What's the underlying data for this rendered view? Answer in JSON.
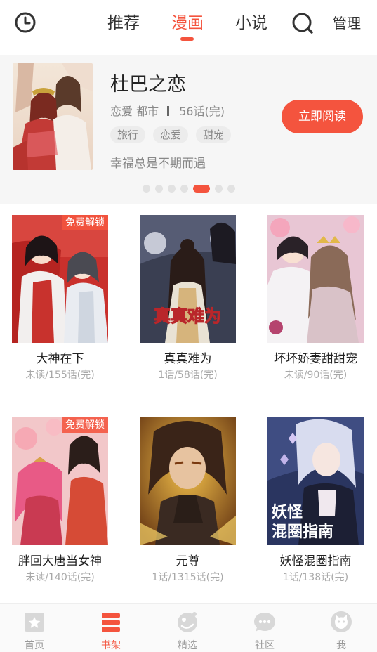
{
  "header": {
    "tabs": [
      {
        "label": "推荐",
        "active": false
      },
      {
        "label": "漫画",
        "active": true
      },
      {
        "label": "小说",
        "active": false
      }
    ],
    "manage_label": "管理",
    "icons": {
      "history": "clock-icon",
      "search": "search-icon"
    },
    "accent_color": "#f4543e"
  },
  "featured": {
    "title": "杜巴之恋",
    "genres": "恋爱 都市",
    "chapters": "56话(完)",
    "tags": [
      "旅行",
      "恋爱",
      "甜宠"
    ],
    "slogan": "幸福总是不期而遇",
    "read_button": "立即阅读",
    "carousel": {
      "total": 7,
      "active_index": 4
    }
  },
  "comics": [
    {
      "title": "大神在下",
      "progress": "未读/155话(完)",
      "badge": "免费解锁"
    },
    {
      "title": "真真难为",
      "progress": "1话/58话(完)",
      "badge": ""
    },
    {
      "title": "坏坏娇妻甜甜宠",
      "progress": "未读/90话(完)",
      "badge": ""
    },
    {
      "title": "胖回大唐当女神",
      "progress": "未读/140话(完)",
      "badge": "免费解锁"
    },
    {
      "title": "元尊",
      "progress": "1话/1315话(完)",
      "badge": ""
    },
    {
      "title": "妖怪混圈指南",
      "progress": "1话/138话(完)",
      "badge": ""
    }
  ],
  "cover_text": {
    "zhenzhen": "真真难为",
    "yaoguai_line1": "妖怪",
    "yaoguai_line2": "混圈指南"
  },
  "bottom_nav": [
    {
      "label": "首页",
      "icon": "home-star-icon",
      "active": false
    },
    {
      "label": "书架",
      "icon": "bookshelf-icon",
      "active": true
    },
    {
      "label": "精选",
      "icon": "featured-face-icon",
      "active": false
    },
    {
      "label": "社区",
      "icon": "chat-bubble-icon",
      "active": false
    },
    {
      "label": "我",
      "icon": "profile-cat-icon",
      "active": false
    }
  ]
}
